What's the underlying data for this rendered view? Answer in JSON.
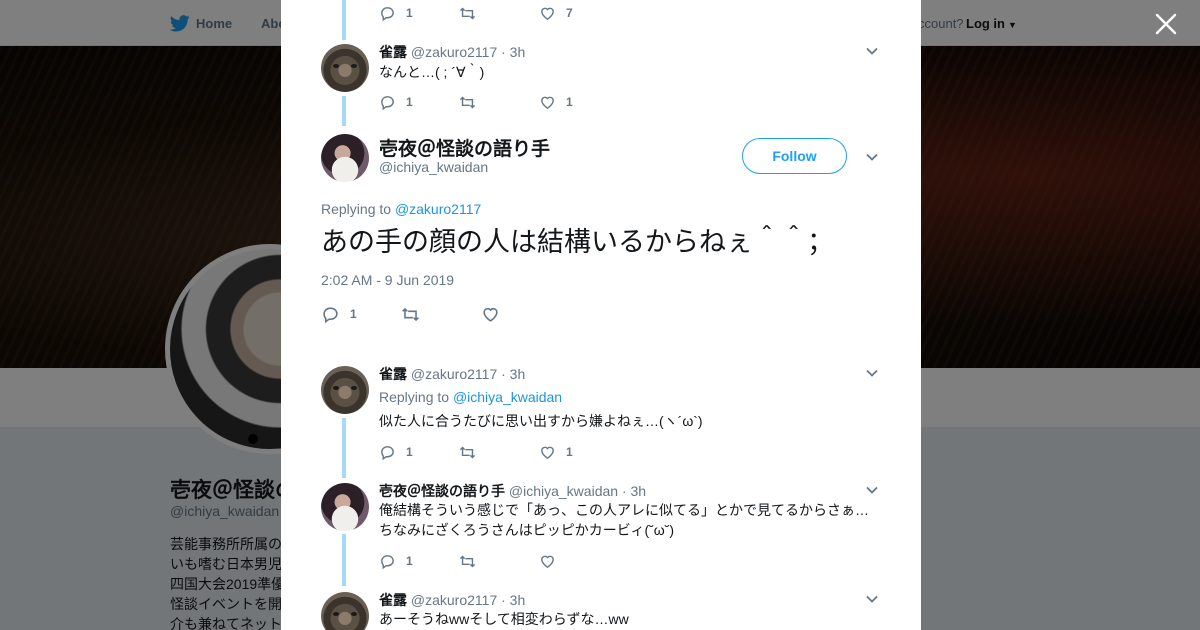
{
  "topbar": {
    "home_label": "Home",
    "about_label": "Abo",
    "account_text": "ccount?",
    "login_label": "Log in"
  },
  "profile": {
    "name": "壱夜＠怪談の",
    "handle": "@ichiya_kwaidan",
    "bio_lines": [
      "芸能事務所所属の",
      "いも嗜む日本男児",
      "四国大会2019準優",
      "怪談イベントを開",
      "介も兼ねてネット"
    ]
  },
  "modal": {
    "tweets_above": [
      {
        "actions": {
          "reply": "1",
          "retweet": "",
          "like": "7"
        }
      },
      {
        "name": "雀露",
        "handle": "@zakuro2117",
        "time": "· 3h",
        "text": "なんと…( ; ´∀｀)",
        "actions": {
          "reply": "1",
          "retweet": "",
          "like": "1"
        }
      }
    ],
    "main_tweet": {
      "name": "壱夜＠怪談の語り手",
      "handle": "@ichiya_kwaidan",
      "follow_label": "Follow",
      "replying_prefix": "Replying to",
      "replying_to": "@zakuro2117",
      "text": "あの手の顔の人は結構いるからねぇ＾＾；",
      "timestamp": "2:02 AM - 9 Jun 2019",
      "actions": {
        "reply": "1",
        "retweet": "",
        "like": ""
      }
    },
    "replies": [
      {
        "name": "雀露",
        "handle": "@zakuro2117",
        "time": "· 3h",
        "replying_prefix": "Replying to",
        "replying_to": "@ichiya_kwaidan",
        "text": "似た人に合うたびに思い出すから嫌よねぇ…(ヽ´ω`)",
        "actions": {
          "reply": "1",
          "retweet": "",
          "like": "1"
        }
      },
      {
        "name": "壱夜＠怪談の語り手",
        "handle": "@ichiya_kwaidan",
        "time": "· 3h",
        "text_line1": "俺結構そういう感じで「あっ、この人アレに似てる」とかで見てるからさぁ…",
        "text_line2": "ちなみにざくろうさんはピッピかカービィ(˘ω˘)",
        "actions": {
          "reply": "1",
          "retweet": "",
          "like": ""
        }
      },
      {
        "name": "雀露",
        "handle": "@zakuro2117",
        "time": "· 3h",
        "text": "あーそうねwwそして相変わらずな…ww"
      }
    ]
  },
  "colors": {
    "accent": "#1da1f2",
    "link": "#1b95e0",
    "muted": "#657786",
    "thread_line": "#a4d9f9",
    "overlay": "rgba(0,0,0,0.5)"
  },
  "icons": [
    "twitter-bird-icon",
    "close-icon",
    "reply-icon",
    "retweet-icon",
    "like-icon",
    "chevron-down-icon"
  ]
}
